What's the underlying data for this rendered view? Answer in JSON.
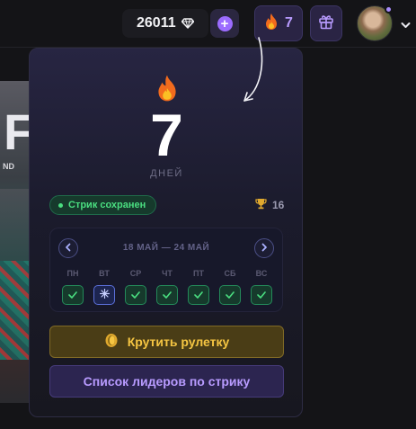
{
  "header": {
    "balance": "26011",
    "balance_icon": "diamond-icon",
    "add_icon": "plus-icon",
    "streak_count": "7",
    "streak_icon": "fire-icon",
    "gift_icon": "gift-icon",
    "avatar_icon": "avatar",
    "menu_icon": "chevron-down-icon"
  },
  "background_card": {
    "title_fragment": "FP",
    "subtitle_fragment": "ND"
  },
  "streak_popup": {
    "streak_value": "7",
    "unit_label": "ДНЕЙ",
    "status": "Стрик сохранен",
    "best_streak": "16",
    "week_range": "18 МАЙ — 24 МАЙ",
    "days": [
      {
        "label": "ПН",
        "state": "done"
      },
      {
        "label": "ВТ",
        "state": "freeze"
      },
      {
        "label": "СР",
        "state": "done"
      },
      {
        "label": "ЧТ",
        "state": "done"
      },
      {
        "label": "ПТ",
        "state": "done"
      },
      {
        "label": "СБ",
        "state": "done"
      },
      {
        "label": "ВС",
        "state": "done"
      }
    ],
    "spin_button": "Крутить рулетку",
    "leaders_button": "Список лидеров по стрику"
  },
  "colors": {
    "accent_purple": "#9c6cff",
    "success_green": "#4ade80",
    "gold": "#f5c542",
    "freeze_blue": "#5b6fd8"
  }
}
